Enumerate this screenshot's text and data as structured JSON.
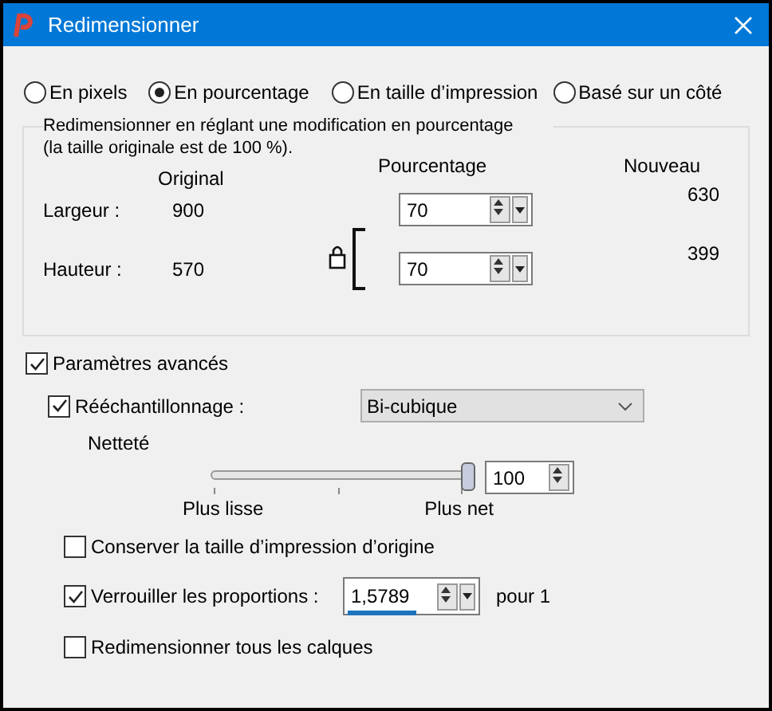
{
  "window": {
    "title": "Redimensionner"
  },
  "modes": [
    {
      "label": "En pixels",
      "selected": false
    },
    {
      "label": "En pourcentage",
      "selected": true
    },
    {
      "label": "En taille d’impression",
      "selected": false
    },
    {
      "label": "Basé sur un côté",
      "selected": false
    }
  ],
  "group": {
    "description": "Redimensionner en réglant une modification en pourcentage\n(la taille originale est de 100 %).",
    "headers": {
      "original": "Original",
      "percentage": "Pourcentage",
      "new": "Nouveau"
    },
    "rows": [
      {
        "label": "Largeur :",
        "original": "900",
        "percentage": "70",
        "new": "630"
      },
      {
        "label": "Hauteur :",
        "original": "570",
        "percentage": "70",
        "new": "399"
      }
    ],
    "locked": true
  },
  "advanced": {
    "label": "Paramètres avancés",
    "checked": true
  },
  "resample": {
    "label": "Rééchantillonnage :",
    "checked": true,
    "method": "Bi-cubique"
  },
  "sharpness": {
    "label": "Netteté",
    "level": 1,
    "min_label": "Plus lisse",
    "max_label": "Plus net",
    "value": "100"
  },
  "keep_print_size": {
    "label": "Conserver la taille d’impression d’origine",
    "checked": false
  },
  "lock_ratio": {
    "label": "Verrouiller les proportions :",
    "checked": true,
    "value": "1,5789",
    "level": 0.5,
    "suffix": "pour 1"
  },
  "all_layers": {
    "label": "Redimensionner tous les calques",
    "checked": false
  }
}
